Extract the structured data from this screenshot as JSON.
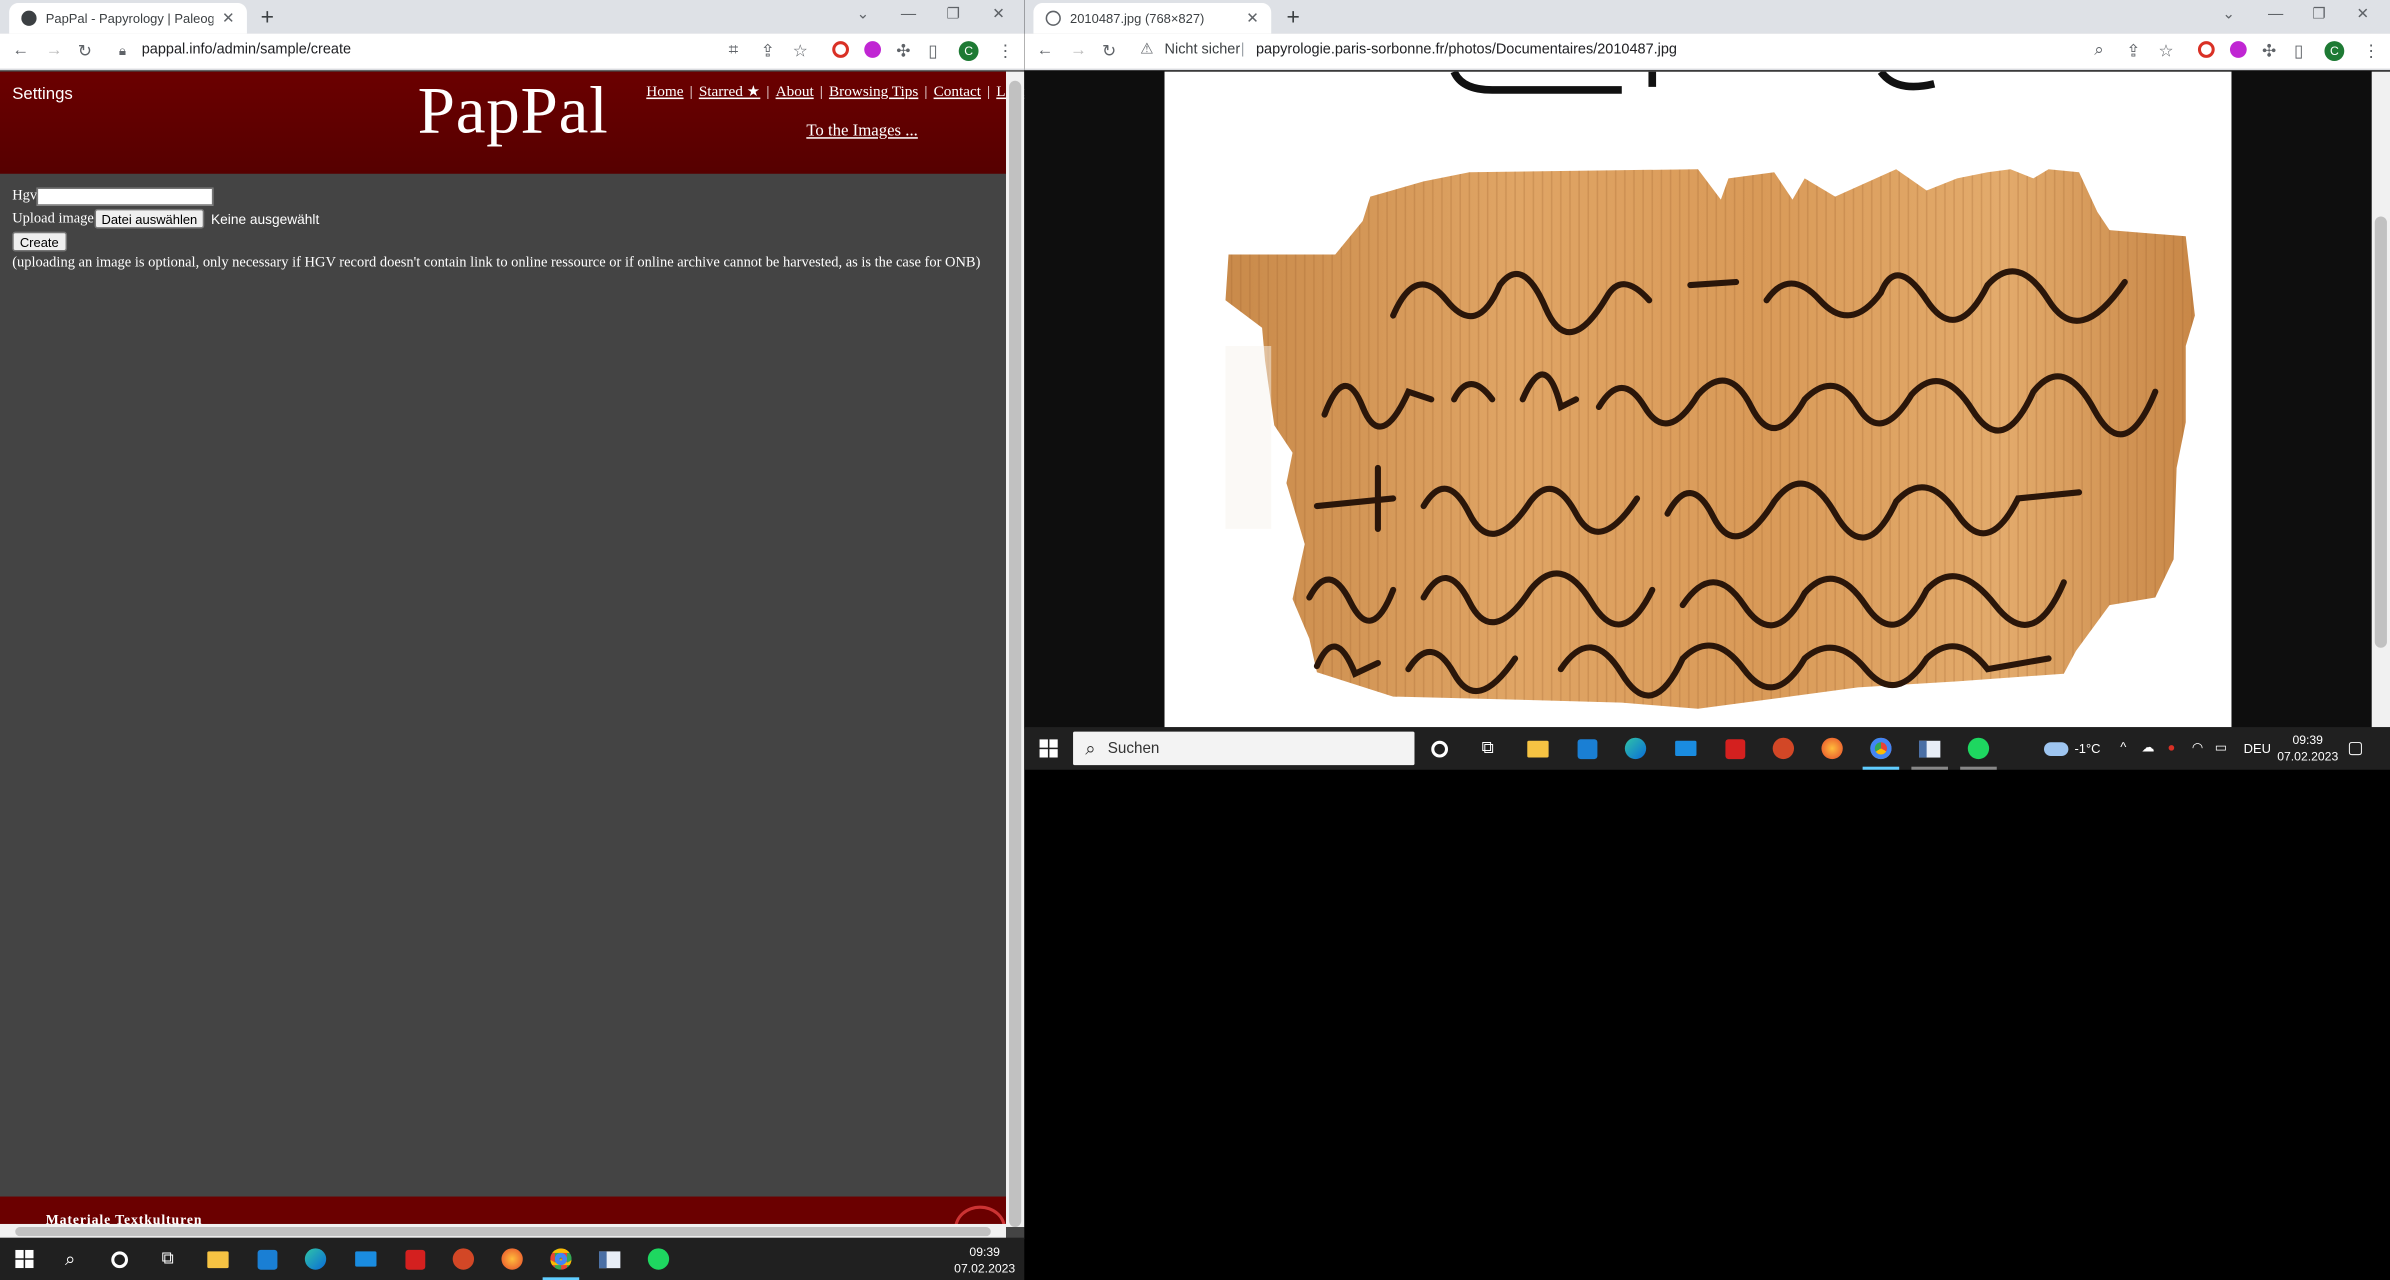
{
  "left_browser": {
    "tab_title": "PapPal - Papyrology | Paleograph",
    "address": "pappal.info/admin/sample/create",
    "profile_initial": "C",
    "site": {
      "settings_label": "Settings",
      "logo": "PapPal",
      "nav": [
        "Home",
        "Starred ★",
        "About",
        "Browsing Tips",
        "Contact",
        "Logou"
      ],
      "to_images": "To the Images ..."
    },
    "form": {
      "hgv_label": "Hgv",
      "upload_label": "Upload image",
      "file_button": "Datei auswählen",
      "file_status": "Keine ausgewählt",
      "create_button": "Create",
      "note": "(uploading an image is optional, only necessary if HGV record doesn't contain link to online ressource or if online archive cannot be harvested, as is the case for ONB)"
    },
    "footer_text": "Materiale Textkulturen",
    "taskbar_time": "09:39",
    "taskbar_date": "07.02.2023"
  },
  "right_browser": {
    "tab_title": "2010487.jpg (768×827)",
    "security_label": "Nicht sicher",
    "address": "papyrologie.paris-sorbonne.fr/photos/Documentaires/2010487.jpg",
    "profile_initial": "C",
    "taskbar": {
      "search_placeholder": "Suchen",
      "weather": "-1°C",
      "language": "DEU",
      "time": "09:39",
      "date": "07.02.2023"
    }
  },
  "colors": {
    "header_red": "#6b0000",
    "page_bg": "#444444",
    "taskbar": "#202020",
    "chrome_tabstrip": "#dee1e6"
  }
}
